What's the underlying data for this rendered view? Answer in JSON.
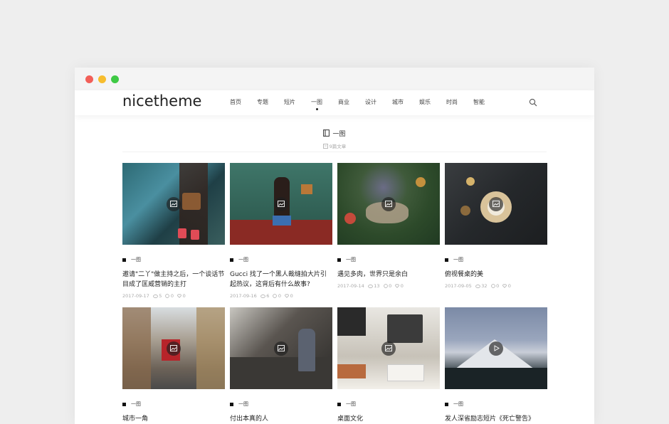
{
  "header": {
    "logo": "nicetheme",
    "nav": [
      "首页",
      "专题",
      "短片",
      "一图",
      "商业",
      "设计",
      "城市",
      "娱乐",
      "时尚",
      "智能"
    ],
    "active_nav": "一图"
  },
  "category": {
    "title": "一图",
    "count": "9篇文章"
  },
  "cards": [
    {
      "category": "一图",
      "title": "邀请\"二丫\"做主持之后，一个谈话节目成了匡威营销的主打",
      "date": "2017-09-17",
      "views": "5",
      "comments": "0",
      "likes": "0",
      "media": "image-icon"
    },
    {
      "category": "一图",
      "title": "Gucci 找了一个黑人裁缝拍大片引起热议，这背后有什么故事?",
      "date": "2017-09-16",
      "views": "6",
      "comments": "0",
      "likes": "0",
      "media": "image-icon"
    },
    {
      "category": "一图",
      "title": "遇见多肉，世界只是余白",
      "date": "2017-09-14",
      "views": "13",
      "comments": "0",
      "likes": "0",
      "media": "image-icon"
    },
    {
      "category": "一图",
      "title": "俯视餐桌的美",
      "date": "2017-09-05",
      "views": "32",
      "comments": "0",
      "likes": "0",
      "media": "image-icon"
    },
    {
      "category": "一图",
      "title": "城市一角",
      "media": "image-icon"
    },
    {
      "category": "一图",
      "title": "付出本真的人",
      "media": "image-icon"
    },
    {
      "category": "一图",
      "title": "桌面文化",
      "media": "image-icon"
    },
    {
      "category": "一图",
      "title": "发人深省励志短片《死亡警告》",
      "media": "play-icon"
    }
  ]
}
